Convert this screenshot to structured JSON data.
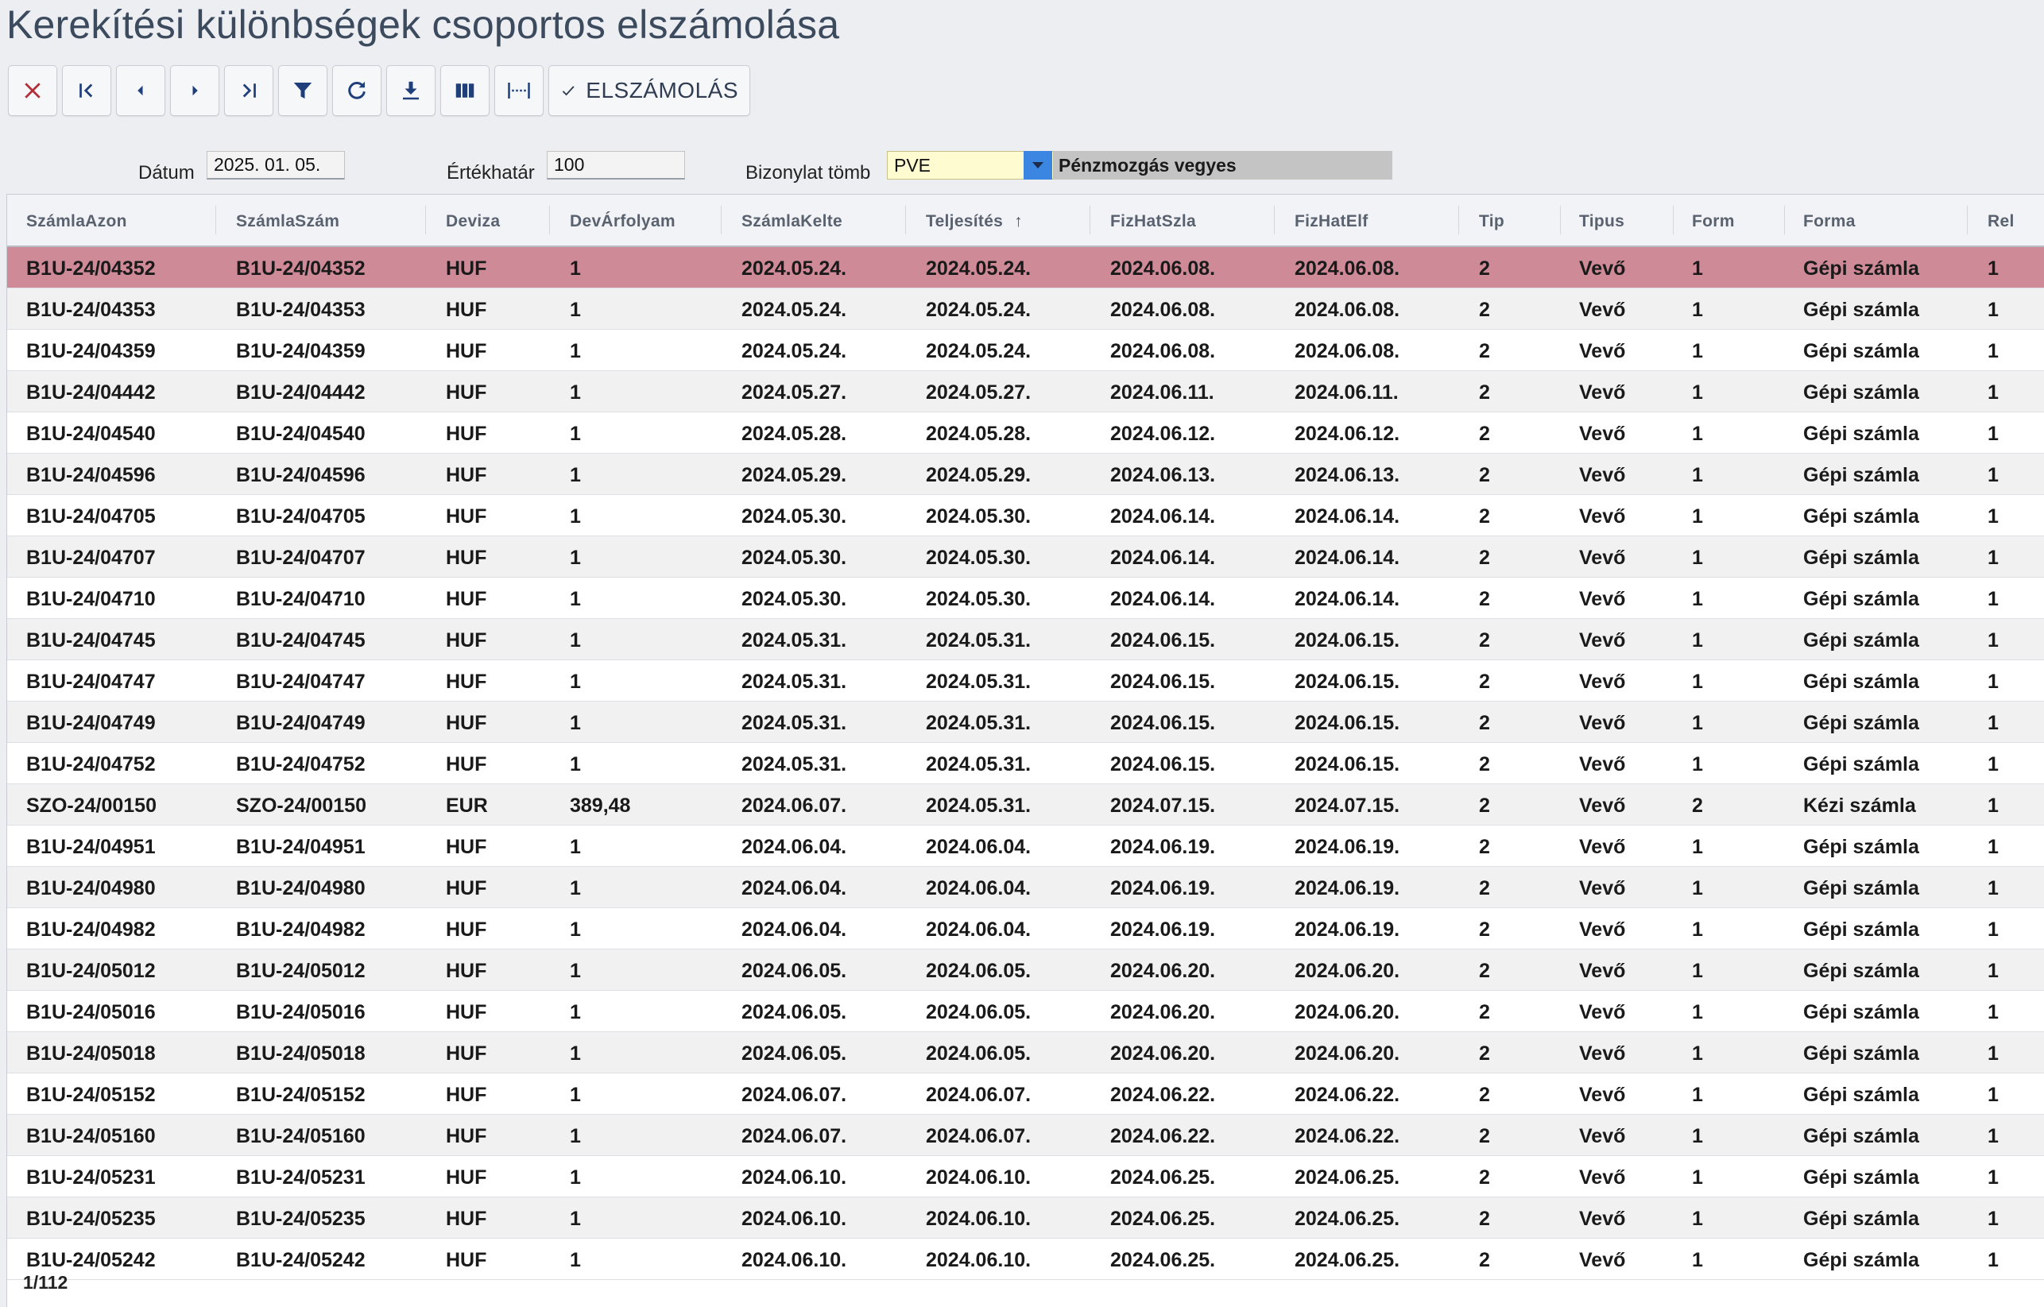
{
  "title": "Kerekítési különbségek csoportos elszámolása",
  "toolbar": {
    "buttons": [
      {
        "icon": "close-icon"
      },
      {
        "icon": "first-page-icon"
      },
      {
        "icon": "prev-icon"
      },
      {
        "icon": "next-icon"
      },
      {
        "icon": "last-page-icon"
      },
      {
        "icon": "filter-icon"
      },
      {
        "icon": "refresh-icon"
      },
      {
        "icon": "download-icon"
      },
      {
        "icon": "columns-icon"
      },
      {
        "icon": "column-width-icon"
      }
    ],
    "settle_label": "ELSZÁMOLÁS"
  },
  "filters": {
    "date_label": "Dátum",
    "date_value": "2025. 01. 05.",
    "threshold_label": "Értékhatár",
    "threshold_value": "100",
    "block_label": "Bizonylat tömb",
    "block_value": "PVE",
    "block_desc": "Pénzmozgás vegyes"
  },
  "columns": [
    "SzámlaAzon",
    "SzámlaSzám",
    "Deviza",
    "DevÁrfolyam",
    "SzámlaKelte",
    "Teljesítés",
    "FizHatSzla",
    "FizHatElf",
    "Tip",
    "Tipus",
    "Form",
    "Forma",
    "Rel"
  ],
  "sort_icon": "↑",
  "rows": [
    [
      "B1U-24/04352",
      "B1U-24/04352",
      "HUF",
      "1",
      "2024.05.24.",
      "2024.05.24.",
      "2024.06.08.",
      "2024.06.08.",
      "2",
      "Vevő",
      "1",
      "Gépi számla",
      "1"
    ],
    [
      "B1U-24/04353",
      "B1U-24/04353",
      "HUF",
      "1",
      "2024.05.24.",
      "2024.05.24.",
      "2024.06.08.",
      "2024.06.08.",
      "2",
      "Vevő",
      "1",
      "Gépi számla",
      "1"
    ],
    [
      "B1U-24/04359",
      "B1U-24/04359",
      "HUF",
      "1",
      "2024.05.24.",
      "2024.05.24.",
      "2024.06.08.",
      "2024.06.08.",
      "2",
      "Vevő",
      "1",
      "Gépi számla",
      "1"
    ],
    [
      "B1U-24/04442",
      "B1U-24/04442",
      "HUF",
      "1",
      "2024.05.27.",
      "2024.05.27.",
      "2024.06.11.",
      "2024.06.11.",
      "2",
      "Vevő",
      "1",
      "Gépi számla",
      "1"
    ],
    [
      "B1U-24/04540",
      "B1U-24/04540",
      "HUF",
      "1",
      "2024.05.28.",
      "2024.05.28.",
      "2024.06.12.",
      "2024.06.12.",
      "2",
      "Vevő",
      "1",
      "Gépi számla",
      "1"
    ],
    [
      "B1U-24/04596",
      "B1U-24/04596",
      "HUF",
      "1",
      "2024.05.29.",
      "2024.05.29.",
      "2024.06.13.",
      "2024.06.13.",
      "2",
      "Vevő",
      "1",
      "Gépi számla",
      "1"
    ],
    [
      "B1U-24/04705",
      "B1U-24/04705",
      "HUF",
      "1",
      "2024.05.30.",
      "2024.05.30.",
      "2024.06.14.",
      "2024.06.14.",
      "2",
      "Vevő",
      "1",
      "Gépi számla",
      "1"
    ],
    [
      "B1U-24/04707",
      "B1U-24/04707",
      "HUF",
      "1",
      "2024.05.30.",
      "2024.05.30.",
      "2024.06.14.",
      "2024.06.14.",
      "2",
      "Vevő",
      "1",
      "Gépi számla",
      "1"
    ],
    [
      "B1U-24/04710",
      "B1U-24/04710",
      "HUF",
      "1",
      "2024.05.30.",
      "2024.05.30.",
      "2024.06.14.",
      "2024.06.14.",
      "2",
      "Vevő",
      "1",
      "Gépi számla",
      "1"
    ],
    [
      "B1U-24/04745",
      "B1U-24/04745",
      "HUF",
      "1",
      "2024.05.31.",
      "2024.05.31.",
      "2024.06.15.",
      "2024.06.15.",
      "2",
      "Vevő",
      "1",
      "Gépi számla",
      "1"
    ],
    [
      "B1U-24/04747",
      "B1U-24/04747",
      "HUF",
      "1",
      "2024.05.31.",
      "2024.05.31.",
      "2024.06.15.",
      "2024.06.15.",
      "2",
      "Vevő",
      "1",
      "Gépi számla",
      "1"
    ],
    [
      "B1U-24/04749",
      "B1U-24/04749",
      "HUF",
      "1",
      "2024.05.31.",
      "2024.05.31.",
      "2024.06.15.",
      "2024.06.15.",
      "2",
      "Vevő",
      "1",
      "Gépi számla",
      "1"
    ],
    [
      "B1U-24/04752",
      "B1U-24/04752",
      "HUF",
      "1",
      "2024.05.31.",
      "2024.05.31.",
      "2024.06.15.",
      "2024.06.15.",
      "2",
      "Vevő",
      "1",
      "Gépi számla",
      "1"
    ],
    [
      "SZO-24/00150",
      "SZO-24/00150",
      "EUR",
      "389,48",
      "2024.06.07.",
      "2024.05.31.",
      "2024.07.15.",
      "2024.07.15.",
      "2",
      "Vevő",
      "2",
      "Kézi számla",
      "1"
    ],
    [
      "B1U-24/04951",
      "B1U-24/04951",
      "HUF",
      "1",
      "2024.06.04.",
      "2024.06.04.",
      "2024.06.19.",
      "2024.06.19.",
      "2",
      "Vevő",
      "1",
      "Gépi számla",
      "1"
    ],
    [
      "B1U-24/04980",
      "B1U-24/04980",
      "HUF",
      "1",
      "2024.06.04.",
      "2024.06.04.",
      "2024.06.19.",
      "2024.06.19.",
      "2",
      "Vevő",
      "1",
      "Gépi számla",
      "1"
    ],
    [
      "B1U-24/04982",
      "B1U-24/04982",
      "HUF",
      "1",
      "2024.06.04.",
      "2024.06.04.",
      "2024.06.19.",
      "2024.06.19.",
      "2",
      "Vevő",
      "1",
      "Gépi számla",
      "1"
    ],
    [
      "B1U-24/05012",
      "B1U-24/05012",
      "HUF",
      "1",
      "2024.06.05.",
      "2024.06.05.",
      "2024.06.20.",
      "2024.06.20.",
      "2",
      "Vevő",
      "1",
      "Gépi számla",
      "1"
    ],
    [
      "B1U-24/05016",
      "B1U-24/05016",
      "HUF",
      "1",
      "2024.06.05.",
      "2024.06.05.",
      "2024.06.20.",
      "2024.06.20.",
      "2",
      "Vevő",
      "1",
      "Gépi számla",
      "1"
    ],
    [
      "B1U-24/05018",
      "B1U-24/05018",
      "HUF",
      "1",
      "2024.06.05.",
      "2024.06.05.",
      "2024.06.20.",
      "2024.06.20.",
      "2",
      "Vevő",
      "1",
      "Gépi számla",
      "1"
    ],
    [
      "B1U-24/05152",
      "B1U-24/05152",
      "HUF",
      "1",
      "2024.06.07.",
      "2024.06.07.",
      "2024.06.22.",
      "2024.06.22.",
      "2",
      "Vevő",
      "1",
      "Gépi számla",
      "1"
    ],
    [
      "B1U-24/05160",
      "B1U-24/05160",
      "HUF",
      "1",
      "2024.06.07.",
      "2024.06.07.",
      "2024.06.22.",
      "2024.06.22.",
      "2",
      "Vevő",
      "1",
      "Gépi számla",
      "1"
    ],
    [
      "B1U-24/05231",
      "B1U-24/05231",
      "HUF",
      "1",
      "2024.06.10.",
      "2024.06.10.",
      "2024.06.25.",
      "2024.06.25.",
      "2",
      "Vevő",
      "1",
      "Gépi számla",
      "1"
    ],
    [
      "B1U-24/05235",
      "B1U-24/05235",
      "HUF",
      "1",
      "2024.06.10.",
      "2024.06.10.",
      "2024.06.25.",
      "2024.06.25.",
      "2",
      "Vevő",
      "1",
      "Gépi számla",
      "1"
    ],
    [
      "B1U-24/05242",
      "B1U-24/05242",
      "HUF",
      "1",
      "2024.06.10.",
      "2024.06.10.",
      "2024.06.25.",
      "2024.06.25.",
      "2",
      "Vevő",
      "1",
      "Gépi számla",
      "1"
    ]
  ],
  "pager": "1/112",
  "colors": {
    "selected_row": "#cf8a98",
    "accent": "#2f3c52",
    "dropdown": "#3a86e0"
  }
}
